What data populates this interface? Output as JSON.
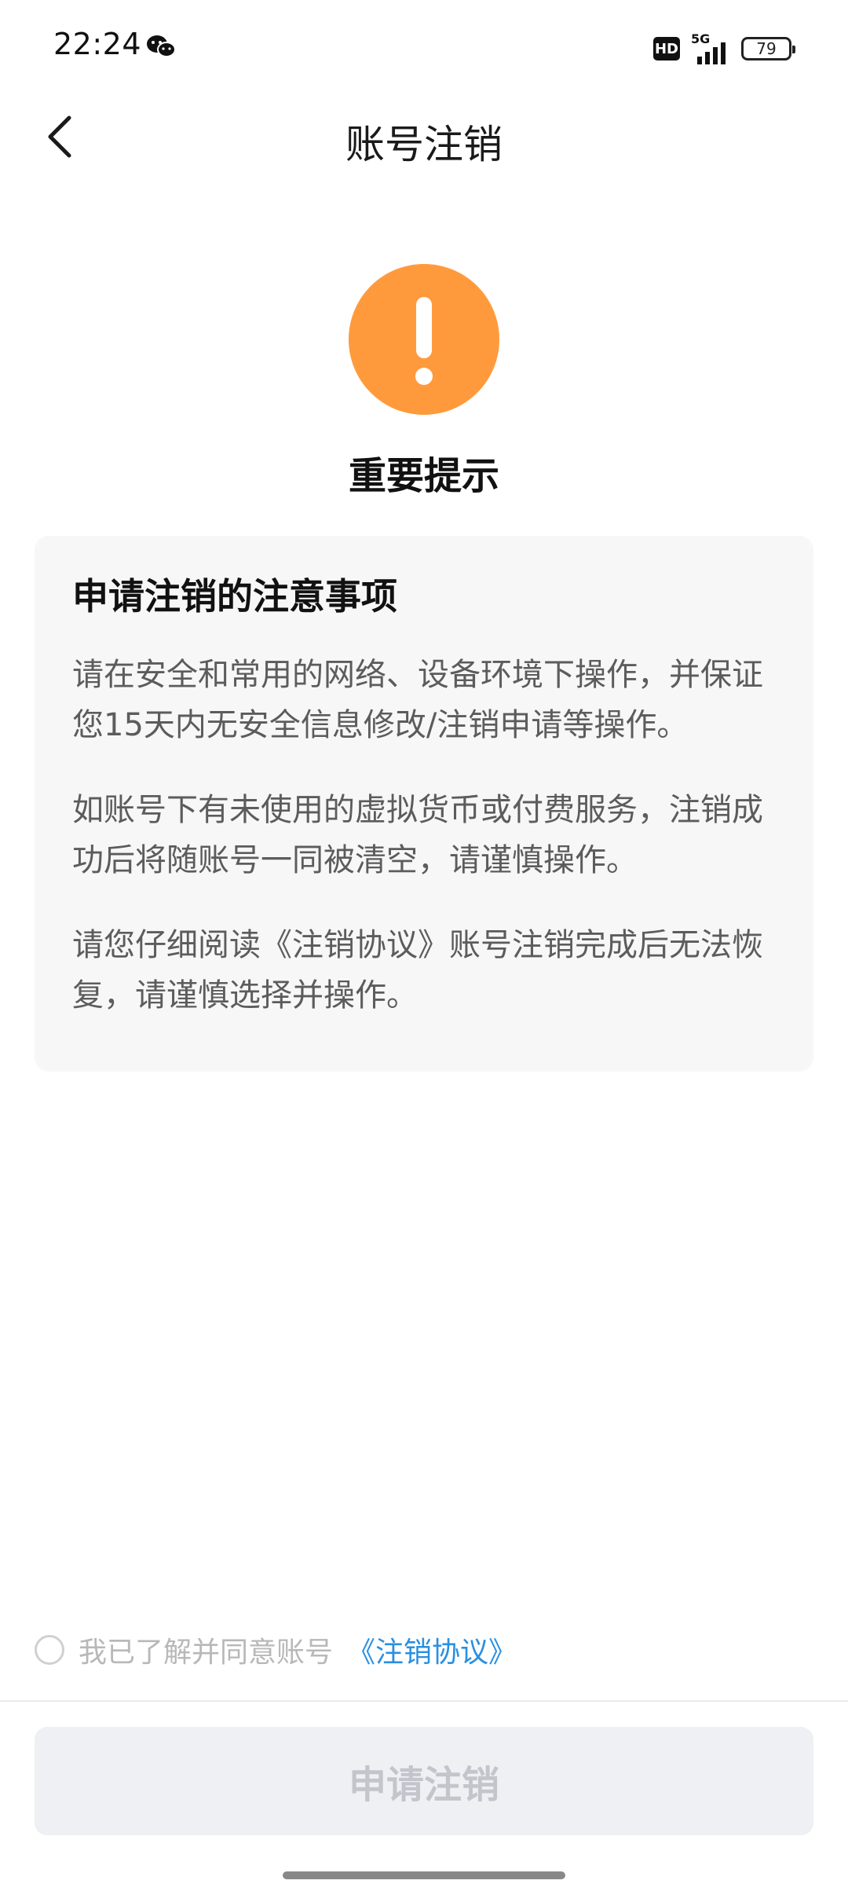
{
  "status_bar": {
    "time": "22:24",
    "hd_label": "HD",
    "network_label": "5G",
    "battery_level": "79"
  },
  "header": {
    "title": "账号注销"
  },
  "warning": {
    "title": "重要提示",
    "icon_color": "#ff9a3c"
  },
  "notice": {
    "heading": "申请注销的注意事项",
    "paragraphs": [
      "请在安全和常用的网络、设备环境下操作，并保证您15天内无安全信息修改/注销申请等操作。",
      "如账号下有未使用的虚拟货币或付费服务，注销成功后将随账号一同被清空，请谨慎操作。",
      "请您仔细阅读《注销协议》账号注销完成后无法恢复，请谨慎选择并操作。"
    ]
  },
  "agreement": {
    "text": "我已了解并同意账号",
    "link_text": "《注销协议》",
    "checked": false,
    "link_color": "#2a8fe0"
  },
  "apply_button": {
    "label": "申请注销",
    "enabled": false
  }
}
